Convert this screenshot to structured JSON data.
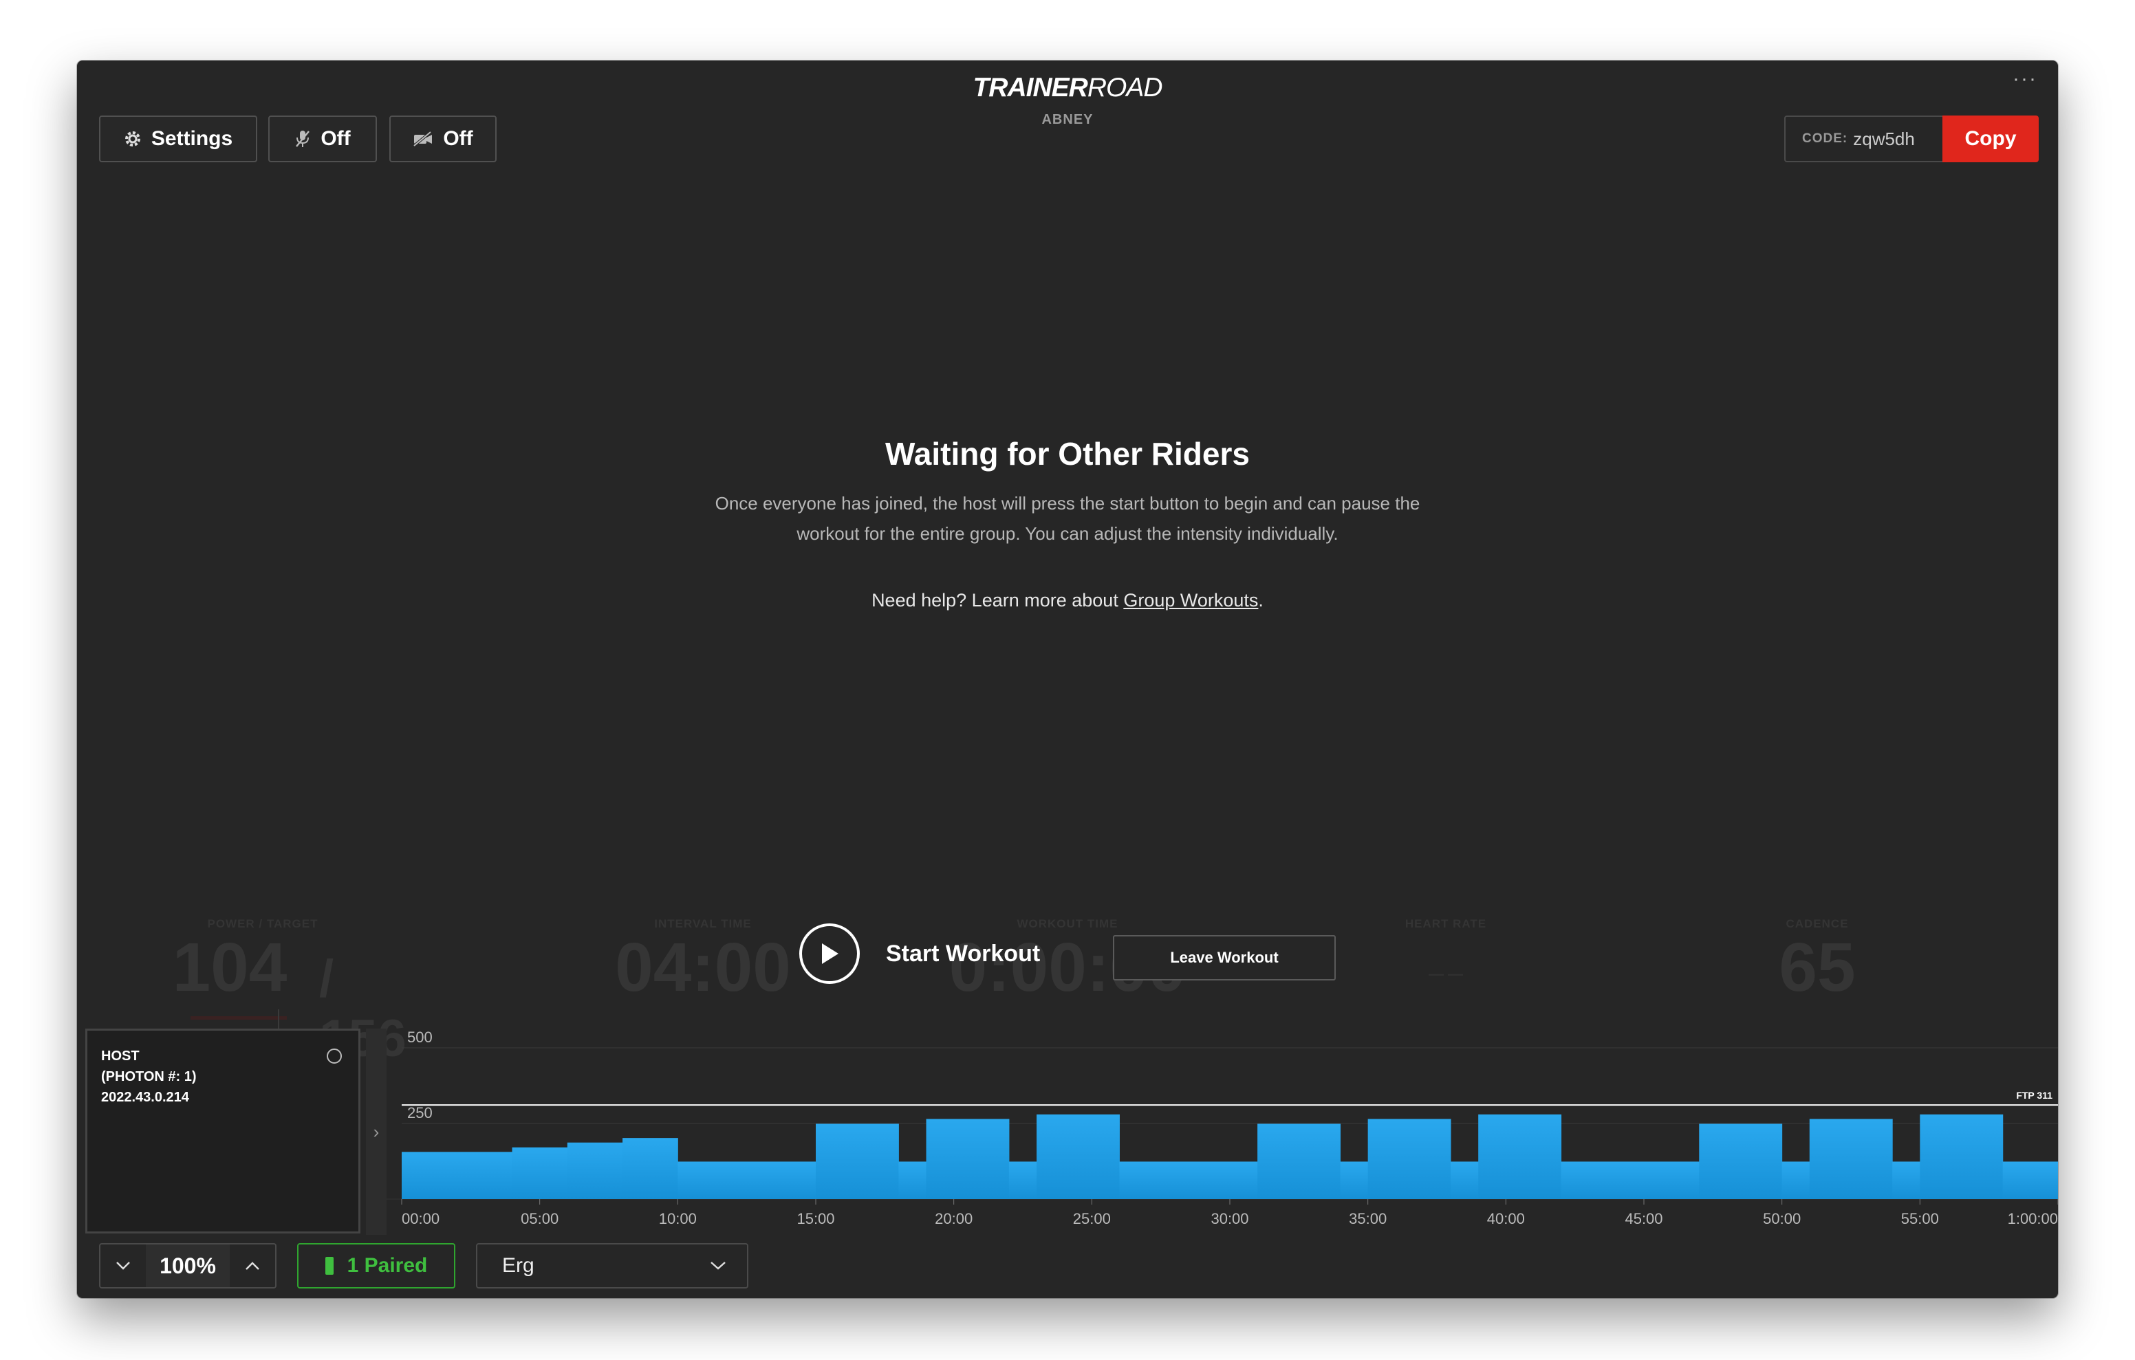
{
  "app": {
    "brand_bold": "TRAINER",
    "brand_light": "ROAD",
    "username": "ABNEY",
    "more_menu": "···"
  },
  "toolbar": {
    "settings_label": "Settings",
    "mic_label": "Off",
    "video_label": "Off"
  },
  "session": {
    "code_label": "CODE:",
    "code_value": "zqw5dh",
    "copy_label": "Copy"
  },
  "waiting": {
    "title": "Waiting for Other Riders",
    "description": "Once everyone has joined, the host will press the start button to begin and can pause the workout for the entire group. You can adjust the intensity individually.",
    "help_prefix": "Need help? Learn more about ",
    "help_link": "Group Workouts",
    "help_suffix": "."
  },
  "metrics": {
    "power_label": "POWER / TARGET",
    "power_value": "104",
    "power_target": "/ 156",
    "interval_label": "INTERVAL TIME",
    "interval_value": "04:00",
    "workout_label": "WORKOUT TIME",
    "workout_value": "0:00:00",
    "hr_label": "HEART RATE",
    "hr_value": "— —",
    "cadence_label": "CADENCE",
    "cadence_value": "65"
  },
  "actions": {
    "start_label": "Start Workout",
    "leave_label": "Leave Workout"
  },
  "host": {
    "line1": "HOST",
    "line2": "(PHOTON #: 1)",
    "line3": "2022.43.0.214"
  },
  "controls": {
    "intensity": "100%",
    "paired": "1 Paired",
    "mode": "Erg"
  },
  "colors": {
    "accent_red": "#e0261c",
    "bar_top": "#2aa8ee",
    "bar_bottom": "#1690d6",
    "paired_green": "#3fbf3f"
  },
  "chart_data": {
    "type": "area",
    "title": "",
    "xlabel": "",
    "ylabel": "",
    "x_ticks": [
      "00:00",
      "05:00",
      "10:00",
      "15:00",
      "20:00",
      "25:00",
      "30:00",
      "35:00",
      "40:00",
      "45:00",
      "50:00",
      "55:00",
      "1:00:00"
    ],
    "y_ticks": [
      "500",
      "250"
    ],
    "ylim": [
      0,
      500
    ],
    "ftp_label": "FTP 311",
    "ftp_value": 311,
    "segments": [
      {
        "start": 0,
        "end": 4,
        "watts": 156
      },
      {
        "start": 4,
        "end": 6,
        "watts": 171
      },
      {
        "start": 6,
        "end": 8,
        "watts": 187
      },
      {
        "start": 8,
        "end": 10,
        "watts": 202
      },
      {
        "start": 10,
        "end": 15,
        "watts": 124
      },
      {
        "start": 15,
        "end": 18,
        "watts": 249
      },
      {
        "start": 18,
        "end": 19,
        "watts": 124
      },
      {
        "start": 19,
        "end": 22,
        "watts": 265
      },
      {
        "start": 22,
        "end": 23,
        "watts": 124
      },
      {
        "start": 23,
        "end": 26,
        "watts": 280
      },
      {
        "start": 26,
        "end": 31,
        "watts": 124
      },
      {
        "start": 31,
        "end": 34,
        "watts": 249
      },
      {
        "start": 34,
        "end": 35,
        "watts": 124
      },
      {
        "start": 35,
        "end": 38,
        "watts": 265
      },
      {
        "start": 38,
        "end": 39,
        "watts": 124
      },
      {
        "start": 39,
        "end": 42,
        "watts": 280
      },
      {
        "start": 42,
        "end": 47,
        "watts": 124
      },
      {
        "start": 47,
        "end": 50,
        "watts": 249
      },
      {
        "start": 50,
        "end": 51,
        "watts": 124
      },
      {
        "start": 51,
        "end": 54,
        "watts": 265
      },
      {
        "start": 54,
        "end": 55,
        "watts": 124
      },
      {
        "start": 55,
        "end": 58,
        "watts": 280
      },
      {
        "start": 58,
        "end": 60,
        "watts": 124
      }
    ],
    "xlim_minutes": [
      0,
      60
    ]
  }
}
